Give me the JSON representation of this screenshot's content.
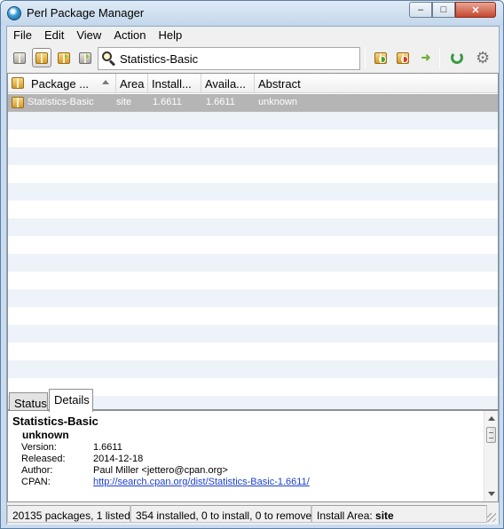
{
  "window": {
    "title": "Perl Package Manager"
  },
  "menu": {
    "items": [
      "File",
      "Edit",
      "View",
      "Action",
      "Help"
    ]
  },
  "search": {
    "value": "Statistics-Basic"
  },
  "columns": [
    "Package ...",
    "Area",
    "Install...",
    "Availa...",
    "Abstract"
  ],
  "packages": [
    {
      "name": "Statistics-Basic",
      "area": "site",
      "installed": "1.6611",
      "available": "1.6611",
      "abstract": "unknown"
    }
  ],
  "tabs": [
    "Status",
    "Details"
  ],
  "details": {
    "name": "Statistics-Basic",
    "abstract": "unknown",
    "version_label": "Version:",
    "version": "1.6611",
    "released_label": "Released:",
    "released": "2014-12-18",
    "author_label": "Author:",
    "author": "Paul Miller <jettero@cpan.org>",
    "cpan_label": "CPAN:",
    "cpan_url": "http://search.cpan.org/dist/Statistics-Basic-1.6611/"
  },
  "status": {
    "counts": "20135 packages,  1 listed",
    "installs": "354 installed,  0  to install,  0  to remove",
    "install_area_label": "Install Area:",
    "install_area": "site"
  }
}
